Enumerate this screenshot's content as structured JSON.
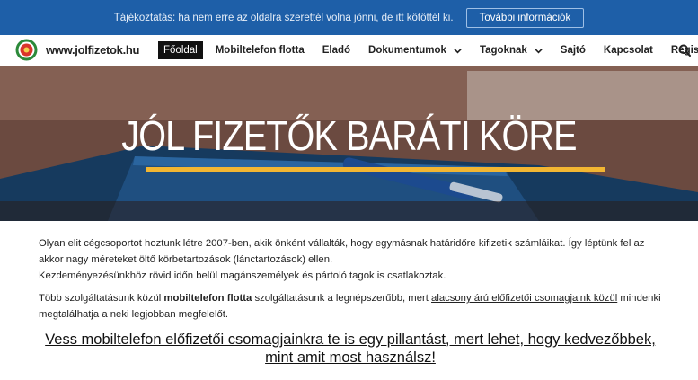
{
  "cookie": {
    "text": "Tájékoztatás: ha nem erre az oldalra szerettél volna jönni, de itt kötöttél ki.",
    "button": "További információk"
  },
  "header": {
    "site_name": "www.jolfizetok.hu",
    "nav": [
      {
        "label": "Főoldal",
        "active": true
      },
      {
        "label": "Mobiltelefon flotta"
      },
      {
        "label": "Eladó"
      },
      {
        "label": "Dokumentumok",
        "dropdown": true
      },
      {
        "label": "Tagoknak",
        "dropdown": true
      },
      {
        "label": "Sajtó"
      },
      {
        "label": "Kapcsolat"
      },
      {
        "label": "Regisztráció"
      }
    ]
  },
  "hero": {
    "title": "JÓL FIZETŐK BARÁTI KÖRE"
  },
  "content": {
    "p1_line": "Olyan elit cégcsoportot hoztunk létre 2007-ben, akik önként vállalták, hogy egymásnak határidőre kifizetik számláikat. Így léptünk fel az akkor nagy méreteket öltő körbetartozások (lánctartozások) ellen.",
    "p1_line2": "Kezdeményezésünkhöz rövid időn belül magánszemélyek és pártoló tagok is csatlakoztak.",
    "p2_a": "Több szolgáltatásunk közül ",
    "p2_b": "mobiltelefon flotta",
    "p2_c": " szolgáltatásunk a legnépszerűbb, mert ",
    "p2_link": "alacsony árú előfizetői csomagjaink közül",
    "p2_d": " mindenki megtalálhatja a neki legjobban megfelelőt.",
    "cta": "Vess mobiltelefon előfizetői csomagjainkra te is egy pillantást, mert lehet, hogy kedvezőbbek, mint amit most használsz!"
  },
  "colors": {
    "cookie_bg": "#1e5fa8",
    "accent_underline": "#f2b632",
    "active_nav_bg": "#111111"
  },
  "icons": [
    "logo-emblem",
    "chevron-down-icon",
    "search-icon"
  ]
}
